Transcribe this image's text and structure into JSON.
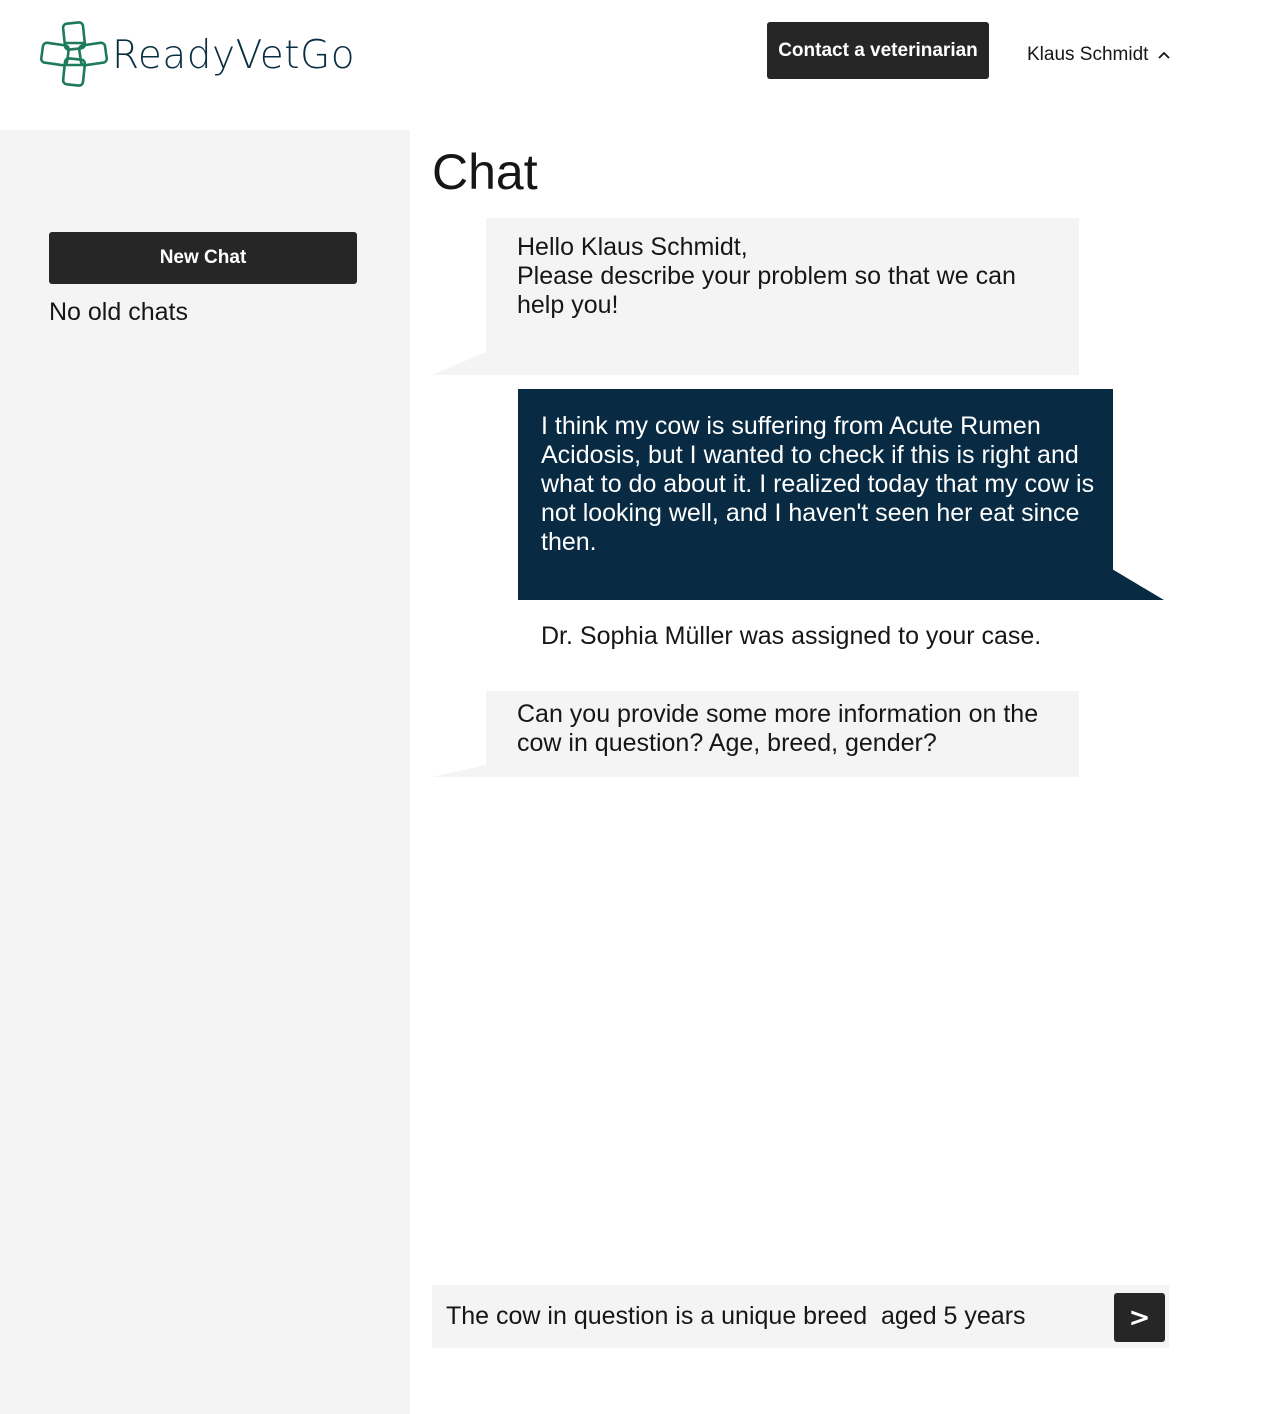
{
  "header": {
    "logo_text": "ReadyVetGo",
    "contact_button_label": "Contact a veterinarian",
    "user_name": "Klaus Schmidt",
    "user_menu_icon": "chevron-up-icon",
    "brand_color": "#1e7a5c",
    "logo_text_color": "#0a2e42"
  },
  "sidebar": {
    "new_chat_label": "New Chat",
    "empty_state": "No old chats"
  },
  "chat": {
    "title": "Chat",
    "messages": [
      {
        "from": "vet",
        "text": "Hello Klaus Schmidt,\nPlease describe your problem so that we can help you!"
      },
      {
        "from": "user",
        "text": "I think my cow is suffering from Acute Rumen Acidosis, but I wanted to check if this is right and what to do about it. I realized today that my cow is not looking well, and I haven't seen her eat since then."
      },
      {
        "from": "system",
        "text": "Dr. Sophia Müller was assigned to your case."
      },
      {
        "from": "vet",
        "text": "Can you provide some more information on the cow in question? Age, breed, gender?"
      }
    ],
    "incoming_color": "#f4f4f4",
    "outgoing_color": "#082a42"
  },
  "composer": {
    "value": "The cow in question is a unique breed  aged 5 years",
    "send_label": ">"
  }
}
